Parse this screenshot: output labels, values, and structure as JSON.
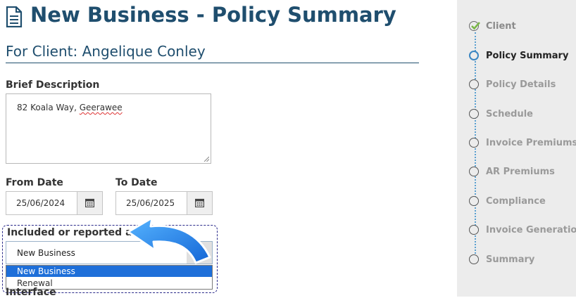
{
  "page": {
    "title": "New Business - Policy Summary",
    "subtitle": "For Client: Angelique Conley"
  },
  "form": {
    "brief_description_label": "Brief Description",
    "brief_description_value_prefix": "82 Koala Way, ",
    "brief_description_value_suffix": "Geerawee",
    "from_date_label": "From Date",
    "from_date_value": "25/06/2024",
    "to_date_label": "To Date",
    "to_date_value": "25/06/2025",
    "included_label": "Included or reported as",
    "included_selected": "New Business",
    "included_options": [
      "New Business",
      "Renewal"
    ],
    "next_label_partial": "Interface"
  },
  "sidebar": {
    "steps": [
      {
        "label": "Client",
        "state": "done"
      },
      {
        "label": "Policy Summary",
        "state": "current"
      },
      {
        "label": "Policy Details",
        "state": "pending"
      },
      {
        "label": "Schedule",
        "state": "pending"
      },
      {
        "label": "Invoice Premiums",
        "state": "pending"
      },
      {
        "label": "AR Premiums",
        "state": "pending"
      },
      {
        "label": "Compliance",
        "state": "pending"
      },
      {
        "label": "Invoice Generation",
        "state": "pending"
      },
      {
        "label": "Summary",
        "state": "pending"
      }
    ]
  },
  "colors": {
    "accent": "#1f4e6e",
    "selected_option": "#1e6fd9",
    "annotation_arrow": "#1e8ef0",
    "step_current": "#3b86c2",
    "check_green": "#7ab648"
  },
  "icons": {
    "title": "document-icon",
    "date_picker": "calendar-icon",
    "select_toggle": "chevron-down-icon",
    "step_done": "check-icon"
  }
}
